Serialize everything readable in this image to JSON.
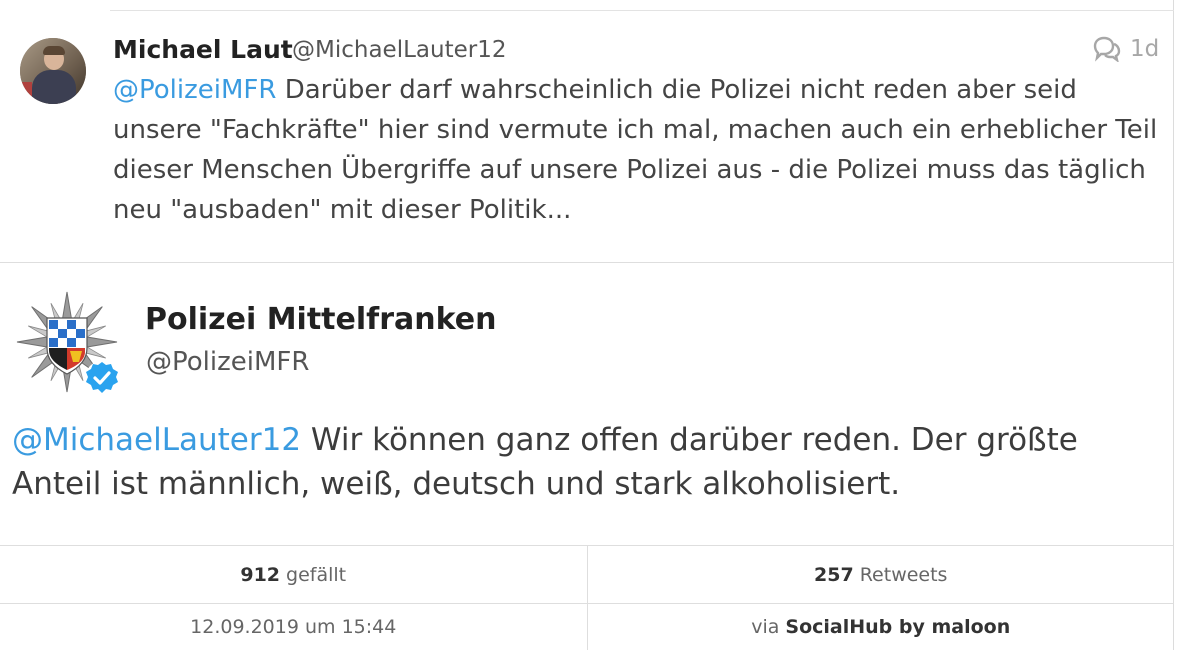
{
  "reply": {
    "author_name": "Michael Laut",
    "author_handle": "@MichaelLauter12",
    "age": "1d",
    "mention": "@PolizeiMFR",
    "text": " Darüber darf wahrscheinlich die Polizei nicht reden aber seid unsere \"Fachkräfte\" hier sind vermute ich mal, machen auch ein erheblicher Teil dieser Menschen Übergriffe auf unsere Polizei aus    - die Polizei muss das täglich neu \"ausbaden\" mit dieser Politik..."
  },
  "tweet": {
    "author_name": "Polizei Mittelfranken",
    "author_handle": "@PolizeiMFR",
    "verified": true,
    "mention": "@MichaelLauter12",
    "text": " Wir können ganz offen darüber reden. Der größte Anteil ist männlich, weiß, deutsch und stark alkoholisiert."
  },
  "stats": {
    "likes_count": "912",
    "likes_label": "gefällt",
    "retweets_count": "257",
    "retweets_label": "Retweets"
  },
  "meta": {
    "timestamp": "12.09.2019 um 15:44",
    "via_label": "via",
    "client": "SocialHub by maloon"
  },
  "icons": {
    "conversation": "conversation-icon",
    "verified": "verified-badge-icon",
    "logo": "police-star-logo"
  },
  "colors": {
    "mention": "#3a9be0",
    "verified": "#2aa3ef"
  }
}
